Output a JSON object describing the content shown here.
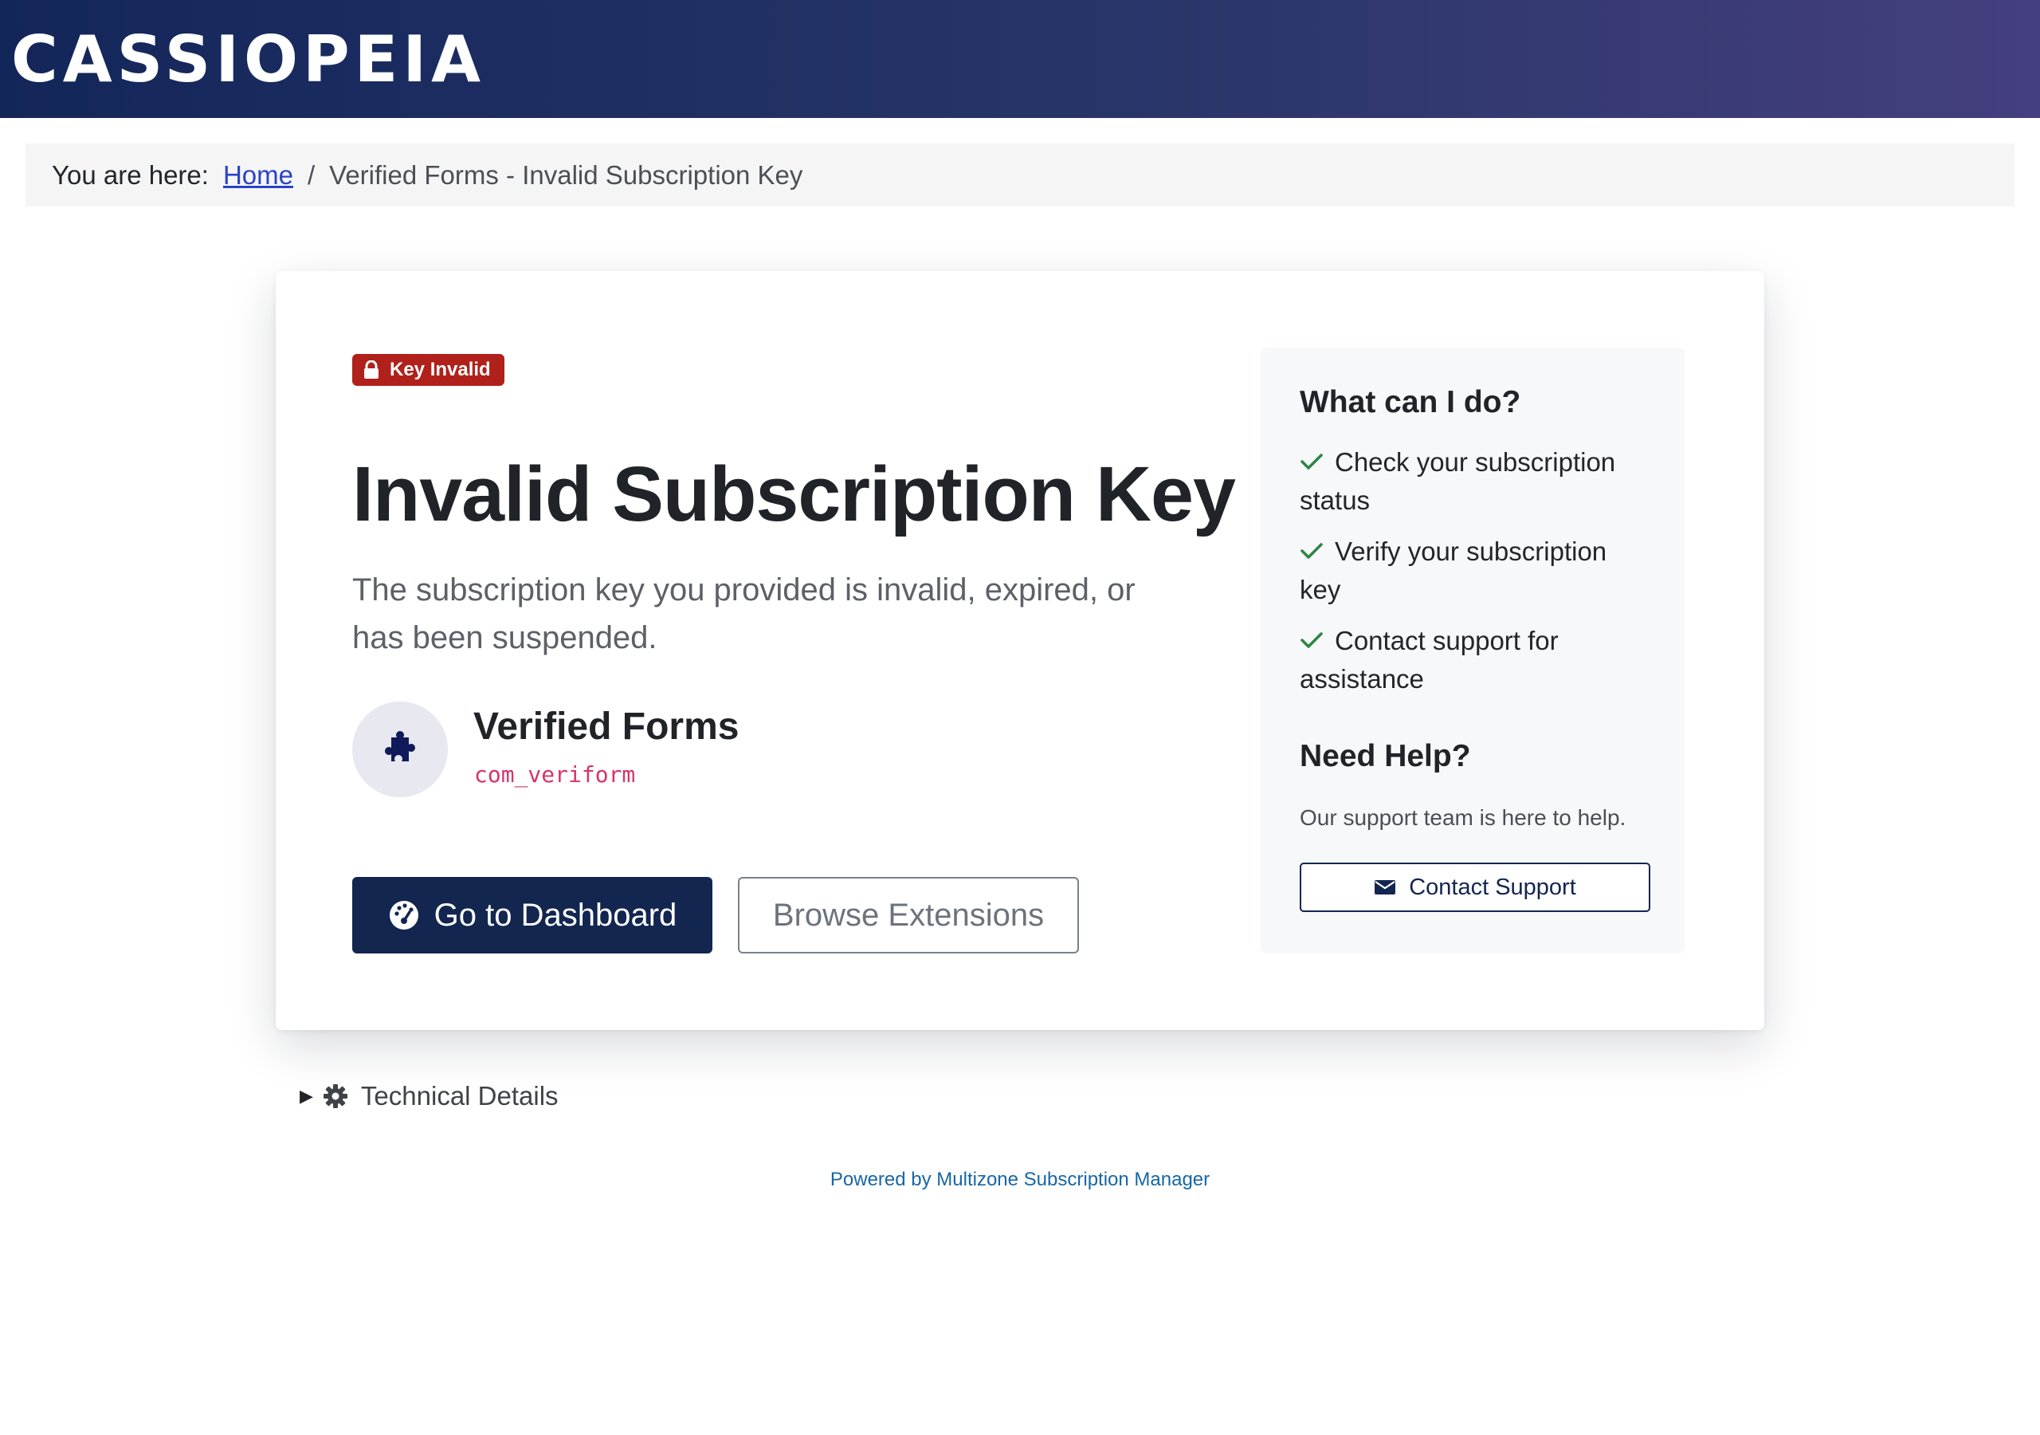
{
  "header": {
    "brand": "CASSIOPEIA"
  },
  "breadcrumb": {
    "prefix": "You are here:",
    "items": [
      {
        "label": "Home"
      },
      {
        "label": "Verified Forms - Invalid Subscription Key"
      }
    ],
    "separator": "/"
  },
  "main": {
    "badge": {
      "label": "Key Invalid",
      "icon": "lock-icon",
      "color": "#b0211b"
    },
    "title": "Invalid Subscription Key",
    "lead": "The subscription key you provided is invalid, expired, or has been suspended.",
    "extension": {
      "name": "Verified Forms",
      "code": "com_veriform",
      "icon": "puzzle-icon"
    },
    "primary_button": {
      "label": "Go to Dashboard",
      "icon": "dashboard-gauge-icon",
      "color": "#132650"
    },
    "secondary_button": {
      "label": "Browse Extensions"
    }
  },
  "aside": {
    "title": "What can I do?",
    "items": [
      {
        "label": "Check your subscription status"
      },
      {
        "label": "Verify your subscription key"
      },
      {
        "label": "Contact support for assistance"
      }
    ],
    "check_color": "#2e8540",
    "help_title": "Need Help?",
    "help_text": "Our support team is here to help.",
    "contact_button": {
      "label": "Contact Support",
      "icon": "envelope-icon"
    }
  },
  "details": {
    "label": "Technical Details",
    "icon": "gear-icon",
    "expanded": false
  },
  "footer": {
    "text": "Powered by Multizone Subscription Manager"
  }
}
